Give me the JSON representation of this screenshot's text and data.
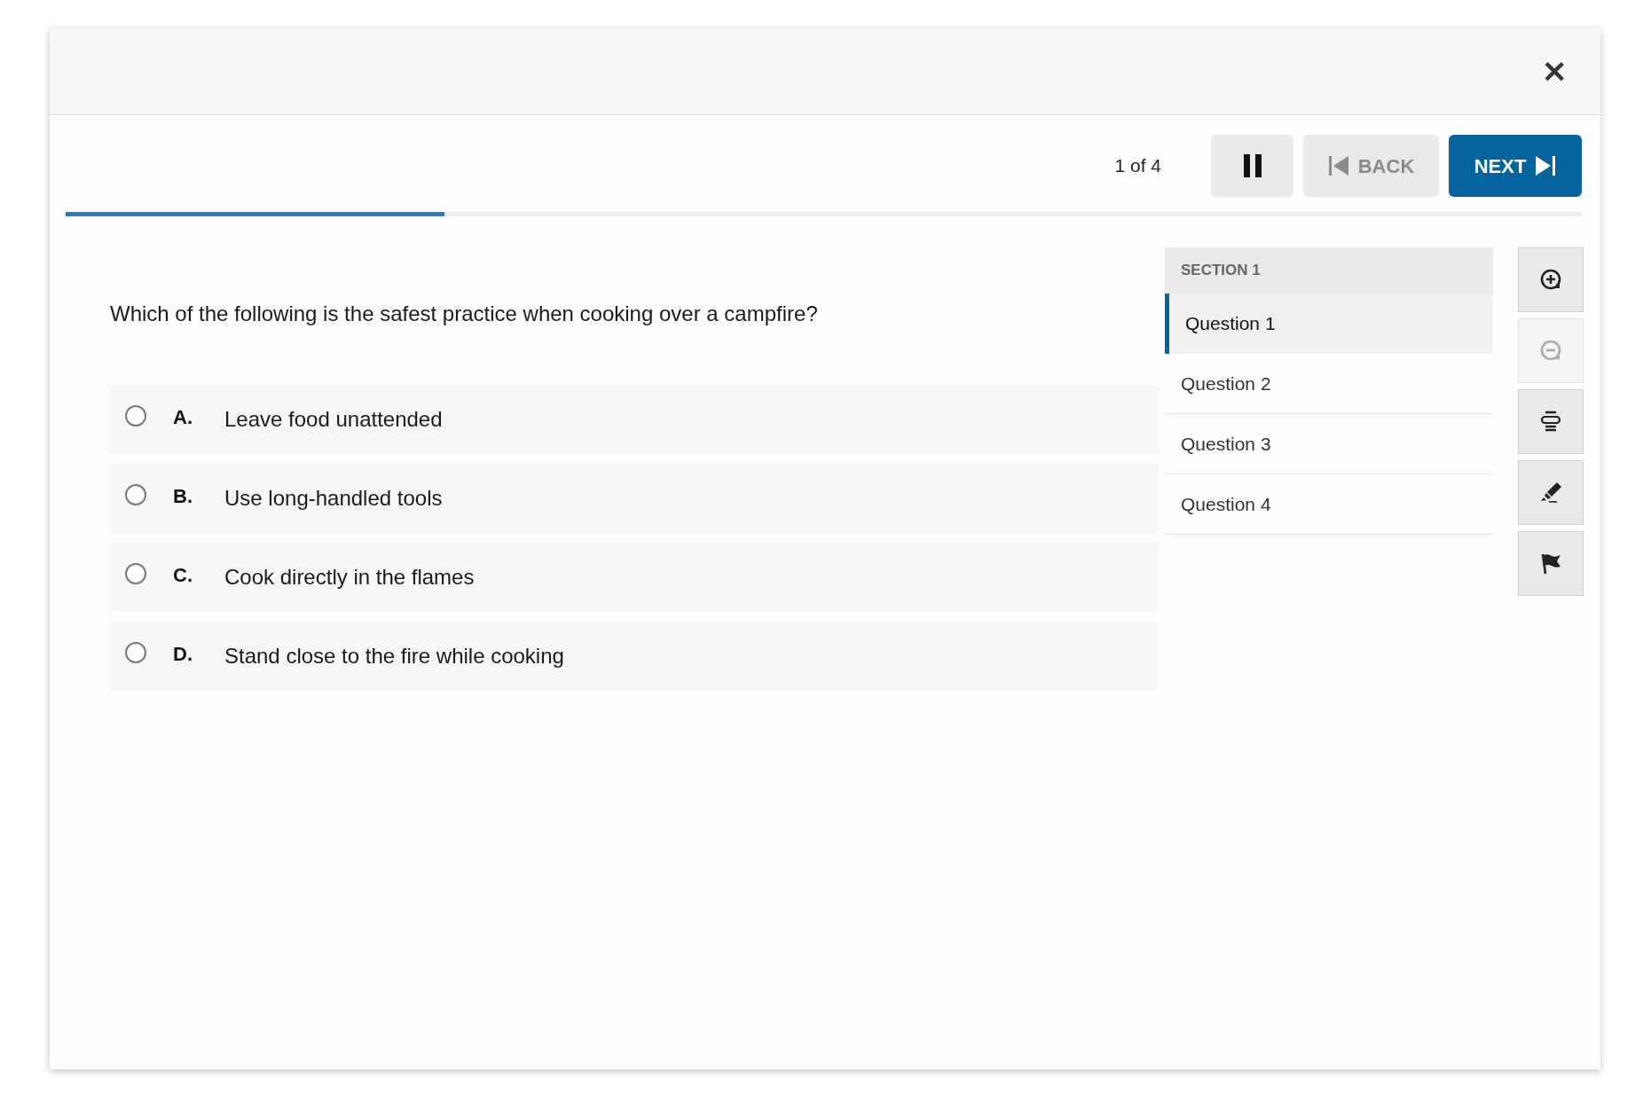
{
  "close_button": {
    "label": "✕"
  },
  "toolbar": {
    "position": "1 of 4",
    "pause": {
      "disabled": false
    },
    "back": {
      "label": "BACK",
      "disabled": true
    },
    "next": {
      "label": "NEXT",
      "disabled": false
    }
  },
  "progress": {
    "level": 0.25
  },
  "question": {
    "text": "Which of the following is the safest practice when cooking over a campfire?",
    "options": [
      {
        "letter": "A.",
        "text": "Leave food unattended",
        "selected": false
      },
      {
        "letter": "B.",
        "text": "Use long-handled tools",
        "selected": false
      },
      {
        "letter": "C.",
        "text": "Cook directly in the flames",
        "selected": false
      },
      {
        "letter": "D.",
        "text": "Stand close to the fire while cooking",
        "selected": false
      }
    ]
  },
  "navigator": {
    "section": "SECTION 1",
    "items": [
      {
        "label": "Question 1",
        "selected": true
      },
      {
        "label": "Question 2",
        "selected": false
      },
      {
        "label": "Question 3",
        "selected": false
      },
      {
        "label": "Question 4",
        "selected": false
      }
    ]
  },
  "tools": [
    {
      "kind": "zoom-in",
      "disabled": false
    },
    {
      "kind": "zoom-out",
      "disabled": true
    },
    {
      "kind": "line-reader",
      "disabled": false
    },
    {
      "kind": "highlighter",
      "disabled": false
    },
    {
      "kind": "flag",
      "disabled": false
    }
  ]
}
